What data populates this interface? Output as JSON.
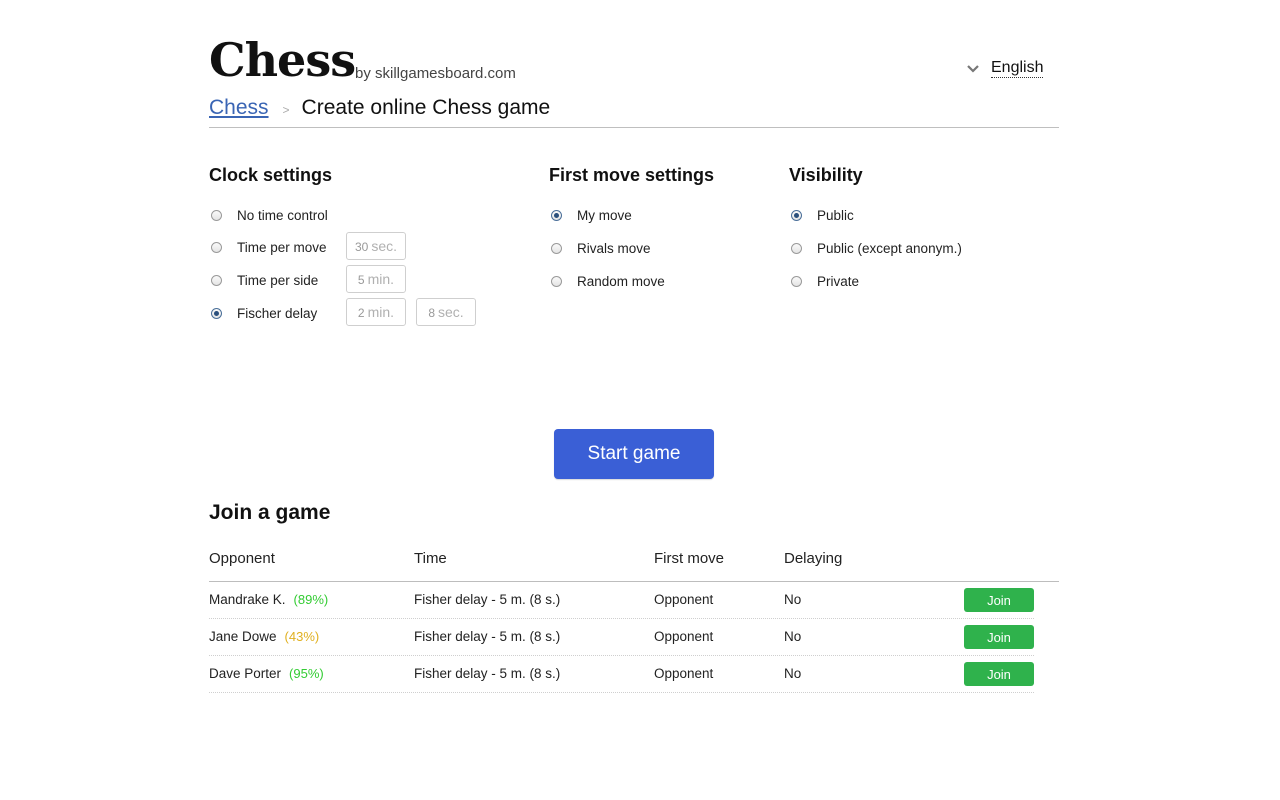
{
  "header": {
    "logo": "Chess",
    "byline": "by skillgamesboard.com",
    "language": "English"
  },
  "breadcrumb": {
    "home": "Chess",
    "separator": ">",
    "current": "Create online Chess game"
  },
  "clock_settings": {
    "title": "Clock settings",
    "options": [
      {
        "label": "No time control",
        "checked": false
      },
      {
        "label": "Time per move",
        "checked": false,
        "value": "30",
        "unit": "sec."
      },
      {
        "label": "Time per side",
        "checked": false,
        "value": "5",
        "unit": "min."
      },
      {
        "label": "Fischer delay",
        "checked": true,
        "value": "2",
        "unit": "min.",
        "value2": "8",
        "unit2": "sec."
      }
    ]
  },
  "first_move_settings": {
    "title": "First move settings",
    "options": [
      {
        "label": "My move",
        "checked": true
      },
      {
        "label": "Rivals move",
        "checked": false
      },
      {
        "label": "Random move",
        "checked": false
      }
    ]
  },
  "visibility": {
    "title": "Visibility",
    "options": [
      {
        "label": "Public",
        "checked": true
      },
      {
        "label": "Public (except anonym.)",
        "checked": false
      },
      {
        "label": "Private",
        "checked": false
      }
    ]
  },
  "start_button": "Start game",
  "join": {
    "title": "Join a game",
    "columns": [
      "Opponent",
      "Time",
      "First move",
      "Delaying"
    ],
    "rows": [
      {
        "opponent": "Mandrake K.",
        "rating": "(89%)",
        "rating_color": "#33cc33",
        "time": "Fisher delay - 5 m. (8 s.)",
        "first_move": "Opponent",
        "delaying": "No",
        "action": "Join"
      },
      {
        "opponent": "Jane Dowe",
        "rating": "(43%)",
        "rating_color": "#e0b020",
        "time": "Fisher delay - 5 m. (8 s.)",
        "first_move": "Opponent",
        "delaying": "No",
        "action": "Join"
      },
      {
        "opponent": "Dave Porter",
        "rating": "(95%)",
        "rating_color": "#33cc33",
        "time": "Fisher delay - 5 m. (8 s.)",
        "first_move": "Opponent",
        "delaying": "No",
        "action": "Join"
      }
    ]
  },
  "colors": {
    "accent": "#3a5fd6",
    "join_button": "#2fb24c",
    "link": "#3a65b4"
  }
}
